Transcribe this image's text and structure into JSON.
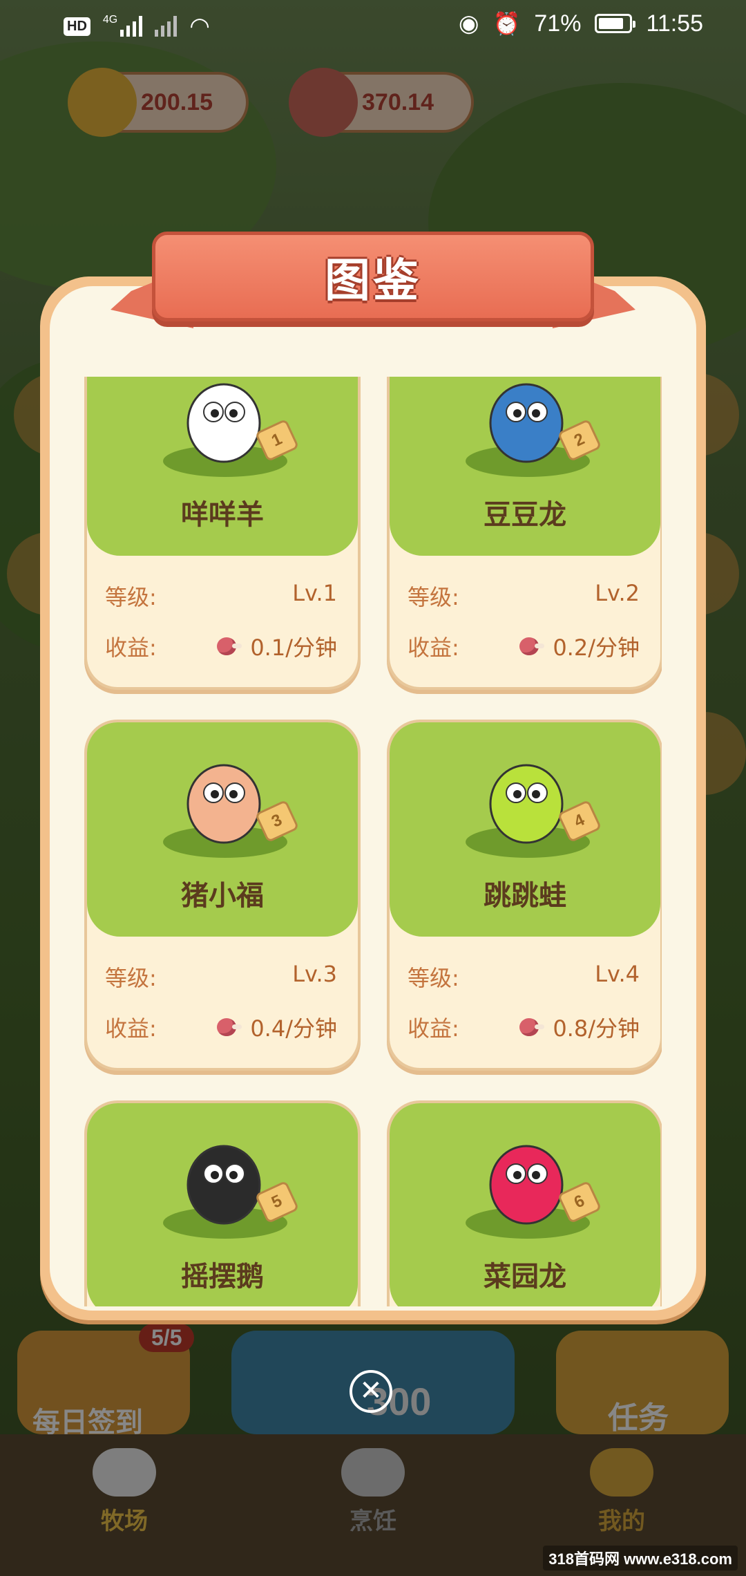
{
  "status_bar": {
    "hd": "HD",
    "network": "4G",
    "battery_percent": "71%",
    "battery_level": 0.71,
    "time": "11:55"
  },
  "game": {
    "coins": "200.15",
    "meat": "370.14",
    "sign_badge": "5/5",
    "sign_label": "每日签到",
    "center_value": "300",
    "task_label": "任务",
    "nav": [
      "牧场",
      "烹饪",
      "我的"
    ]
  },
  "modal": {
    "title": "图鉴",
    "level_label": "等级:",
    "income_label": "收益:",
    "cards": [
      {
        "name": "咩咩羊",
        "level": "Lv.1",
        "income": "0.1/分钟",
        "tag": "1",
        "color": "#ffffff"
      },
      {
        "name": "豆豆龙",
        "level": "Lv.2",
        "income": "0.2/分钟",
        "tag": "2",
        "color": "#3a7fc7"
      },
      {
        "name": "猪小福",
        "level": "Lv.3",
        "income": "0.4/分钟",
        "tag": "3",
        "color": "#f3b38f"
      },
      {
        "name": "跳跳蛙",
        "level": "Lv.4",
        "income": "0.8/分钟",
        "tag": "4",
        "color": "#b9e13b"
      },
      {
        "name": "摇摆鹅",
        "level": "",
        "income": "",
        "tag": "5",
        "color": "#2b2b2b"
      },
      {
        "name": "菜园龙",
        "level": "",
        "income": "",
        "tag": "6",
        "color": "#e8285a"
      }
    ],
    "close_icon": "close-icon"
  },
  "watermark": "318首码网 www.e318.com"
}
